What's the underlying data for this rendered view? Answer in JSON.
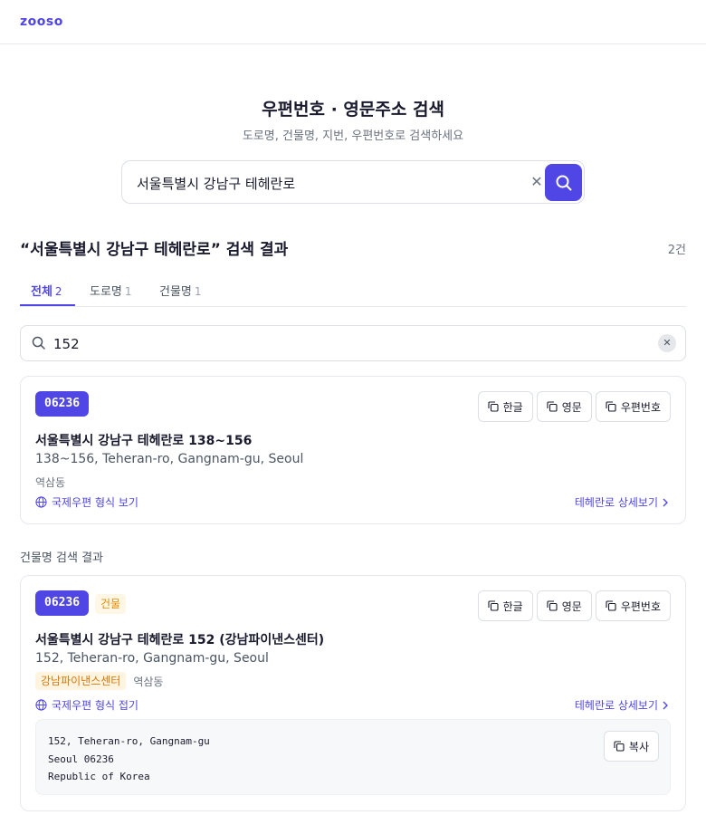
{
  "header": {
    "logo": "zooso"
  },
  "hero": {
    "title": "우편번호 · 영문주소 검색",
    "subtitle": "도로명, 건물명, 지번, 우편번호로 검색하세요"
  },
  "search": {
    "value": "서울특별시 강남구 테헤란로"
  },
  "results": {
    "title": "“서울특별시 강남구 테헤란로” 검색 결과",
    "count": "2건"
  },
  "tabs": [
    {
      "label": "전체",
      "count": "2"
    },
    {
      "label": "도로명",
      "count": "1"
    },
    {
      "label": "건물명",
      "count": "1"
    }
  ],
  "filter": {
    "value": "152"
  },
  "copy_labels": {
    "korean": "한글",
    "english": "영문",
    "zip": "우편번호"
  },
  "cards": [
    {
      "zip": "06236",
      "address_ko": "서울특별시 강남구 테헤란로 138~156",
      "address_en": "138~156, Teheran-ro, Gangnam-gu, Seoul",
      "dong": "역삼동",
      "intl_toggle": "국제우편 형식 보기",
      "detail_link": "테헤란로 상세보기"
    },
    {
      "zip": "06236",
      "type_badge": "건물",
      "address_ko": "서울특별시 강남구 테헤란로 152 (강남파이낸스센터)",
      "address_en": "152, Teheran-ro, Gangnam-gu, Seoul",
      "building_tag": "강남파이낸스센터",
      "dong": "역삼동",
      "intl_toggle": "국제우편 형식 접기",
      "detail_link": "테헤란로 상세보기",
      "intl_lines": [
        "152, Teheran-ro, Gangnam-gu",
        "Seoul 06236",
        "Republic of Korea"
      ],
      "intl_copy": "복사"
    }
  ],
  "section_label": "건물명 검색 결과",
  "colors": {
    "accent": "#4f46e5",
    "badge_orange": "#e08a00"
  }
}
